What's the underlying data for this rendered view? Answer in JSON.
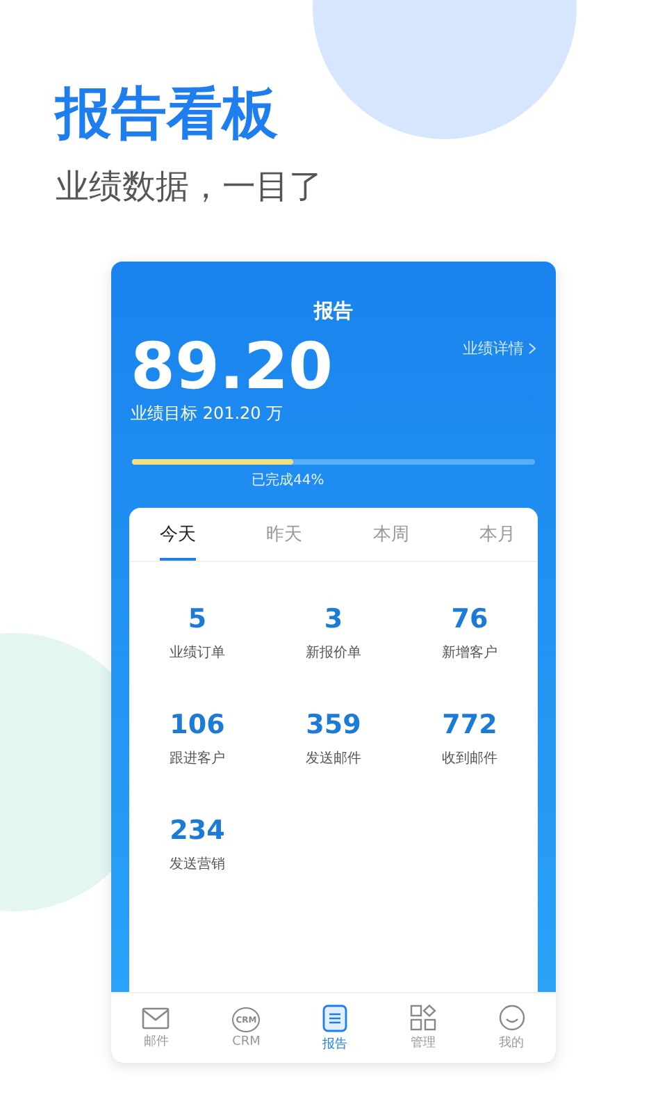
{
  "headline": "报告看板",
  "subtitle": "业绩数据，一目了",
  "screen": {
    "title": "报告",
    "amount": "89.20",
    "target": "业绩目标 201.20 万",
    "details_link": "业绩详情",
    "progress": {
      "level": 0.4,
      "label": "已完成44%"
    }
  },
  "tabs": [
    {
      "label": "今天",
      "selected": true
    },
    {
      "label": "昨天",
      "selected": false
    },
    {
      "label": "本周",
      "selected": false
    },
    {
      "label": "本月",
      "selected": false
    }
  ],
  "stats": [
    {
      "value": "5",
      "label": "业绩订单"
    },
    {
      "value": "3",
      "label": "新报价单"
    },
    {
      "value": "76",
      "label": "新增客户"
    },
    {
      "value": "106",
      "label": "跟进客户"
    },
    {
      "value": "359",
      "label": "发送邮件"
    },
    {
      "value": "772",
      "label": "收到邮件"
    },
    {
      "value": "234",
      "label": "发送营销"
    }
  ],
  "nav": [
    {
      "kind": "mail",
      "label": "邮件",
      "selected": false
    },
    {
      "kind": "crm",
      "label": "CRM",
      "icon_text": "CRM",
      "selected": false
    },
    {
      "kind": "report",
      "label": "报告",
      "selected": true
    },
    {
      "kind": "manage",
      "label": "管理",
      "selected": false
    },
    {
      "kind": "me",
      "label": "我的",
      "selected": false
    }
  ]
}
